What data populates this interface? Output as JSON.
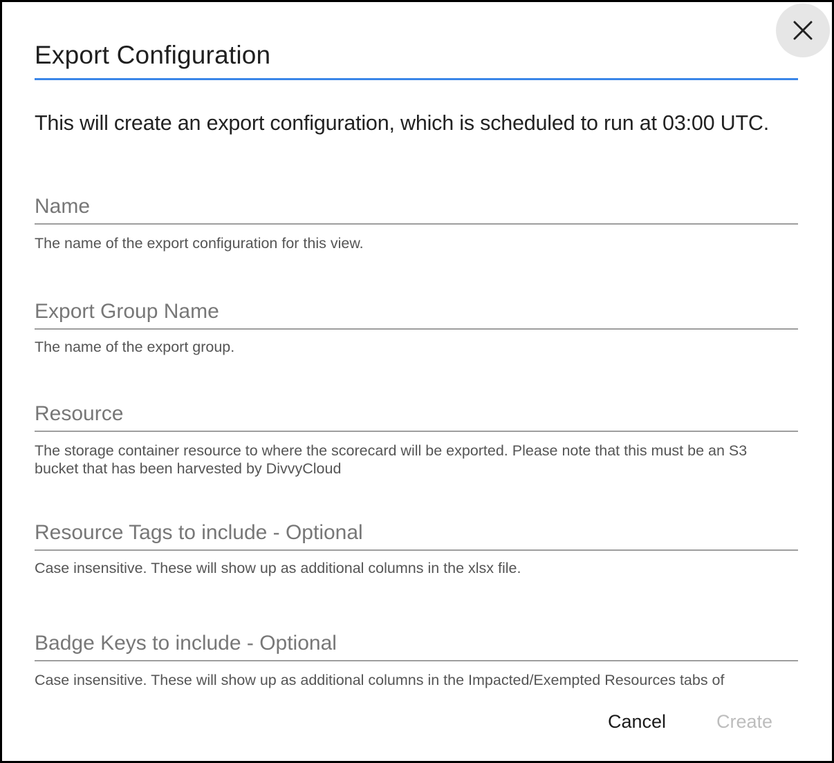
{
  "dialog": {
    "title": "Export Configuration",
    "intro": "This will create an export configuration, which is scheduled to run at 03:00 UTC.",
    "accent_color": "#3a86e8",
    "close_icon": "close-icon"
  },
  "fields": {
    "name": {
      "placeholder": "Name",
      "value": "",
      "helper": "The name of the export configuration for this view."
    },
    "export_group_name": {
      "placeholder": "Export Group Name",
      "value": "",
      "helper": "The name of the export group."
    },
    "resource": {
      "placeholder": "Resource",
      "value": "",
      "helper": "The storage container resource to where the scorecard will be exported. Please note that this must be an S3 bucket that has been harvested by DivvyCloud"
    },
    "resource_tags": {
      "placeholder": "Resource Tags to include - Optional",
      "value": "",
      "helper": "Case insensitive. These will show up as additional columns in the xlsx file."
    },
    "badge_keys": {
      "placeholder": "Badge Keys to include - Optional",
      "value": "",
      "helper": "Case insensitive. These will show up as additional columns in the Impacted/Exempted Resources tabs of"
    }
  },
  "actions": {
    "cancel_label": "Cancel",
    "create_label": "Create",
    "create_disabled": true
  }
}
